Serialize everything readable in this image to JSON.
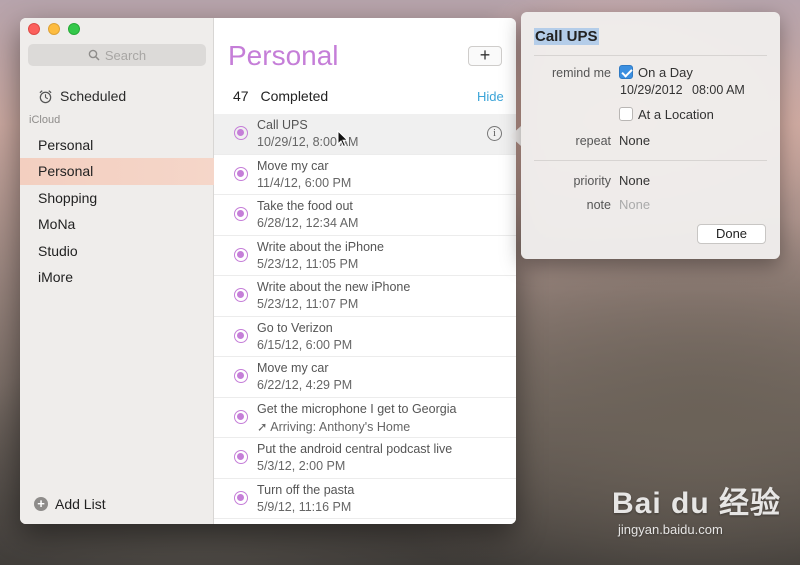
{
  "sidebar": {
    "search_placeholder": "Search",
    "scheduled_label": "Scheduled",
    "section_label": "iCloud",
    "lists": [
      "Personal",
      "Personal",
      "Shopping",
      "MoNa",
      "Studio",
      "iMore"
    ],
    "selected_index": 1,
    "add_list_label": "Add List"
  },
  "main": {
    "title": "Personal",
    "add_button": "+",
    "completed_count": "47",
    "completed_label": "Completed",
    "hide_label": "Hide",
    "items": [
      {
        "title": "Call UPS",
        "subtitle": "10/29/12, 8:00 AM"
      },
      {
        "title": "Move my car",
        "subtitle": "11/4/12, 6:00 PM"
      },
      {
        "title": "Take the food out",
        "subtitle": "6/28/12, 12:34 AM"
      },
      {
        "title": "Write about the iPhone",
        "subtitle": "5/23/12, 11:05 PM"
      },
      {
        "title": "Write about the new iPhone",
        "subtitle": "5/23/12, 11:07 PM"
      },
      {
        "title": "Go to Verizon",
        "subtitle": "6/15/12, 6:00 PM"
      },
      {
        "title": "Move my car",
        "subtitle": "6/22/12, 4:29 PM"
      },
      {
        "title": "Get the microphone I get to Georgia",
        "subtitle": "➚ Arriving: Anthony's Home"
      },
      {
        "title": "Put the android central podcast live",
        "subtitle": "5/3/12, 2:00 PM"
      },
      {
        "title": "Turn off the pasta",
        "subtitle": "5/9/12, 11:16 PM"
      }
    ],
    "selected_item_index": 0
  },
  "popover": {
    "title": "Call UPS",
    "remind_me_label": "remind me",
    "on_a_day_label": "On a Day",
    "on_a_day_checked": true,
    "date": "10/29/2012",
    "time": "08:00 AM",
    "at_location_label": "At a Location",
    "at_location_checked": false,
    "repeat_label": "repeat",
    "repeat_value": "None",
    "priority_label": "priority",
    "priority_value": "None",
    "note_label": "note",
    "note_placeholder": "None",
    "done_label": "Done"
  },
  "watermark": {
    "main": "Bai du 经验",
    "sub": "jingyan.baidu.com"
  },
  "colors": {
    "accent_purple": "#c57ed8",
    "link_blue": "#3ba4d8",
    "checkbox_blue": "#3b8fe0",
    "selected_list_bg": "#f3cfc0"
  }
}
